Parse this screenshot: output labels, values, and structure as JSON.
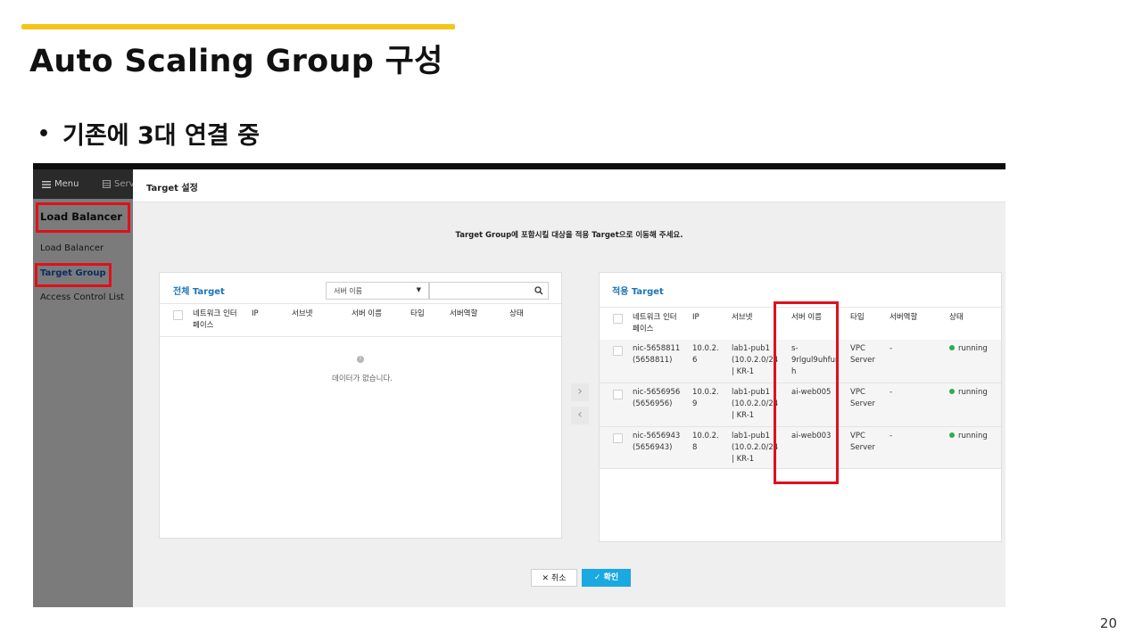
{
  "slide": {
    "title": "Auto Scaling Group 구성",
    "bullet": "기존에 3대 연결 중",
    "page_number": "20"
  },
  "nav": {
    "menu_label": "Menu",
    "server_label": "Serv"
  },
  "sidebar": {
    "title": "Load Balancer",
    "items": [
      {
        "label": "Load Balancer"
      },
      {
        "label": "Target Group"
      },
      {
        "label": "Access Control List"
      }
    ]
  },
  "modal": {
    "title": "Target 설정",
    "guide": "Target Group에 포함시킬 대상을 적용 Target으로 이동해 주세요.",
    "left_panel": {
      "title": "전체 Target",
      "select_value": "서버 이름",
      "search_placeholder": "",
      "columns": [
        "네트워크 인터\n페이스",
        "IP",
        "서브넷",
        "서버 이름",
        "타입",
        "서버역할",
        "상태"
      ],
      "empty_text": "데이터가 없습니다."
    },
    "right_panel": {
      "title": "적용 Target",
      "columns": [
        "네트워크 인터\n페이스",
        "IP",
        "서브넷",
        "서버 이름",
        "타입",
        "서버역할",
        "상태"
      ],
      "rows": [
        {
          "nic": "nic-5658811\n(5658811)",
          "ip": "10.0.2.\n6",
          "subnet": "lab1-pub1\n(10.0.2.0/24\n| KR-1",
          "server": "s-\n9rlgul9uhfur\nh",
          "type": "VPC\nServer",
          "role": "-",
          "status": "running"
        },
        {
          "nic": "nic-5656956\n(5656956)",
          "ip": "10.0.2.\n9",
          "subnet": "lab1-pub1\n(10.0.2.0/24\n| KR-1",
          "server": "ai-web005",
          "type": "VPC\nServer",
          "role": "-",
          "status": "running"
        },
        {
          "nic": "nic-5656943\n(5656943)",
          "ip": "10.0.2.\n8",
          "subnet": "lab1-pub1\n(10.0.2.0/24\n| KR-1",
          "server": "ai-web003",
          "type": "VPC\nServer",
          "role": "-",
          "status": "running"
        }
      ]
    },
    "buttons": {
      "cancel": "취소",
      "ok": "확인"
    }
  },
  "colors": {
    "accent": "#f5c518",
    "highlight": "#e0101a",
    "link": "#1c74b8",
    "ok_button": "#1aa9e0",
    "running": "#29b04a"
  }
}
